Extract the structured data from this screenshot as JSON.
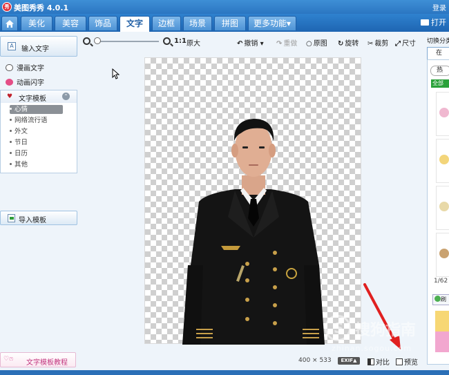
{
  "app": {
    "icon_text": "秀",
    "title": "美图秀秀 4.0.1",
    "login": "登录"
  },
  "tabs": [
    {
      "label": "美化"
    },
    {
      "label": "美容"
    },
    {
      "label": "饰品"
    },
    {
      "label": "文字"
    },
    {
      "label": "边框"
    },
    {
      "label": "场景"
    },
    {
      "label": "拼图"
    },
    {
      "label": "更多功能▾"
    }
  ],
  "active_tab": "文字",
  "open_label": "打开",
  "left_panel": {
    "input_text": "输入文字",
    "comic_text": "漫画文字",
    "animated_text": "动画闪字",
    "template_header": "文字模板",
    "template_items": [
      "心情",
      "网络流行语",
      "外文",
      "节日",
      "日历",
      "其他"
    ],
    "import_template": "导入模板",
    "tutorial": "文字模板教程"
  },
  "toolbar": {
    "ratio": "1:1",
    "ratio_label": "原大",
    "undo": "撤销",
    "redo": "重做",
    "original": "原图",
    "rotate": "旋转",
    "crop": "裁剪",
    "size": "尺寸"
  },
  "status": {
    "image_size": "400 × 533",
    "exif": "EXIF▲",
    "compare": "对比",
    "preview": "预览"
  },
  "right_panel": {
    "title": "切换分类",
    "tab": "在",
    "hot": "热",
    "all": "全部",
    "pager": "1/62",
    "weibo": "刷"
  },
  "watermark": {
    "text": "搜狗指南",
    "url": "zhinan.sogou.com"
  },
  "colors": {
    "title_bar": "#2b76c2",
    "tab_active_text": "#1f5ea5",
    "uniform": "#141414",
    "annotation_arrow": "#e02020"
  }
}
